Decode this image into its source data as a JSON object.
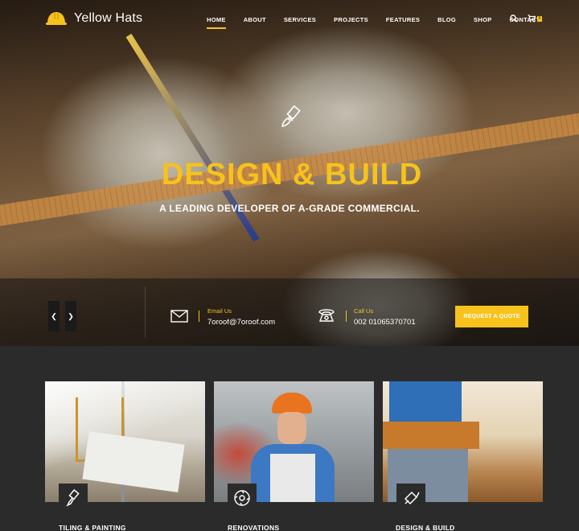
{
  "brand": {
    "name": "Yellow Hats",
    "accent": "#f7c21c"
  },
  "nav": {
    "items": [
      "HOME",
      "ABOUT",
      "SERVICES",
      "PROJECTS",
      "FEATURES",
      "BLOG",
      "SHOP",
      "CONTACT"
    ],
    "active": "HOME",
    "cart_count": "0"
  },
  "hero": {
    "icon": "paint-brush-icon",
    "title": "DESIGN & BUILD",
    "subtitle": "A LEADING DEVELOPER OF A-GRADE COMMERCIAL."
  },
  "contact": {
    "email_label": "Email Us",
    "email_value": "7oroof@7oroof.com",
    "phone_label": "Call Us",
    "phone_value": "002 01065370701",
    "quote_button": "REQUEST A QUOTE"
  },
  "services": [
    {
      "title": "TILING & PAINTING",
      "icon": "paint-roller-icon"
    },
    {
      "title": "RENOVATIONS",
      "icon": "saw-blade-icon"
    },
    {
      "title": "DESIGN & BUILD",
      "icon": "trowel-icon"
    }
  ]
}
